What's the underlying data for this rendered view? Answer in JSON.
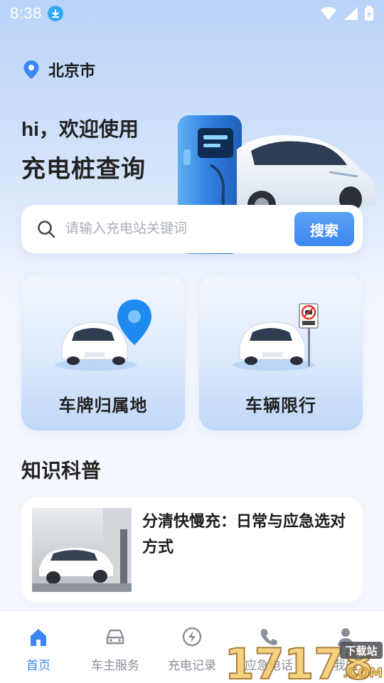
{
  "status_bar": {
    "time": "8:38"
  },
  "location": {
    "city": "北京市"
  },
  "hero": {
    "greeting": "hi，欢迎使用",
    "headline": "充电桩查询"
  },
  "search": {
    "placeholder": "请输入充电站关键词",
    "value": "",
    "button_label": "搜索"
  },
  "features": [
    {
      "label": "车牌归属地",
      "icon": "car-location-pin-icon"
    },
    {
      "label": "车辆限行",
      "icon": "car-no-entry-sign-icon"
    }
  ],
  "knowledge": {
    "title": "知识科普",
    "articles": [
      {
        "title": "分清快慢充：日常与应急选对方式"
      }
    ]
  },
  "bottom_nav": {
    "items": [
      {
        "label": "首页",
        "icon": "home-icon",
        "active": true
      },
      {
        "label": "车主服务",
        "icon": "car-icon",
        "active": false
      },
      {
        "label": "充电记录",
        "icon": "bolt-icon",
        "active": false
      },
      {
        "label": "应急电话",
        "icon": "phone-icon",
        "active": false
      },
      {
        "label": "我的",
        "icon": "person-icon",
        "active": false
      }
    ]
  },
  "watermark": {
    "text": "17178",
    "suffix": ".COM",
    "badge": "下载站"
  },
  "colors": {
    "accent": "#3b86f0",
    "nav_inactive": "#8a8f99"
  }
}
